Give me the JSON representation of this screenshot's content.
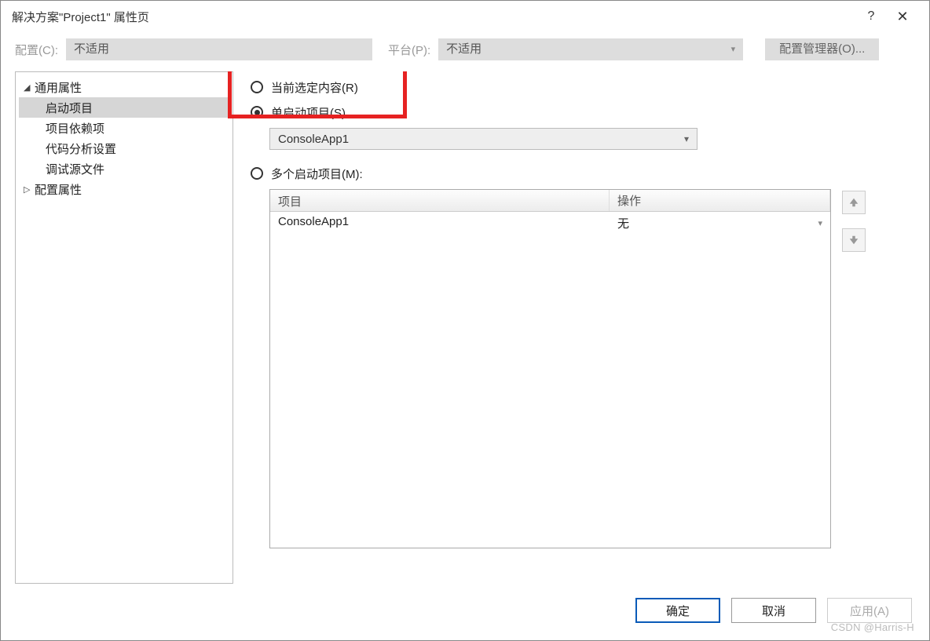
{
  "title": "解决方案\"Project1\" 属性页",
  "titlebar": {
    "help": "?",
    "close": "✕"
  },
  "config_row": {
    "config_label": "配置(C):",
    "config_value": "不适用",
    "platform_label": "平台(P):",
    "platform_value": "不适用",
    "manager_button": "配置管理器(O)..."
  },
  "sidebar": {
    "nodes": [
      {
        "label": "通用属性",
        "expanded": true,
        "level": 0
      },
      {
        "label": "启动项目",
        "selected": true,
        "level": 1
      },
      {
        "label": "项目依赖项",
        "level": 1
      },
      {
        "label": "代码分析设置",
        "level": 1
      },
      {
        "label": "调试源文件",
        "level": 1
      },
      {
        "label": "配置属性",
        "expanded": false,
        "level": 0
      }
    ]
  },
  "startup": {
    "radio_current": "当前选定内容(R)",
    "radio_single": "单启动项目(S)",
    "single_selection": "ConsoleApp1",
    "radio_multi": "多个启动项目(M):",
    "table": {
      "col_project": "项目",
      "col_action": "操作",
      "rows": [
        {
          "project": "ConsoleApp1",
          "action": "无"
        }
      ]
    }
  },
  "footer": {
    "ok": "确定",
    "cancel": "取消",
    "apply": "应用(A)"
  },
  "watermark": "CSDN @Harris-H"
}
